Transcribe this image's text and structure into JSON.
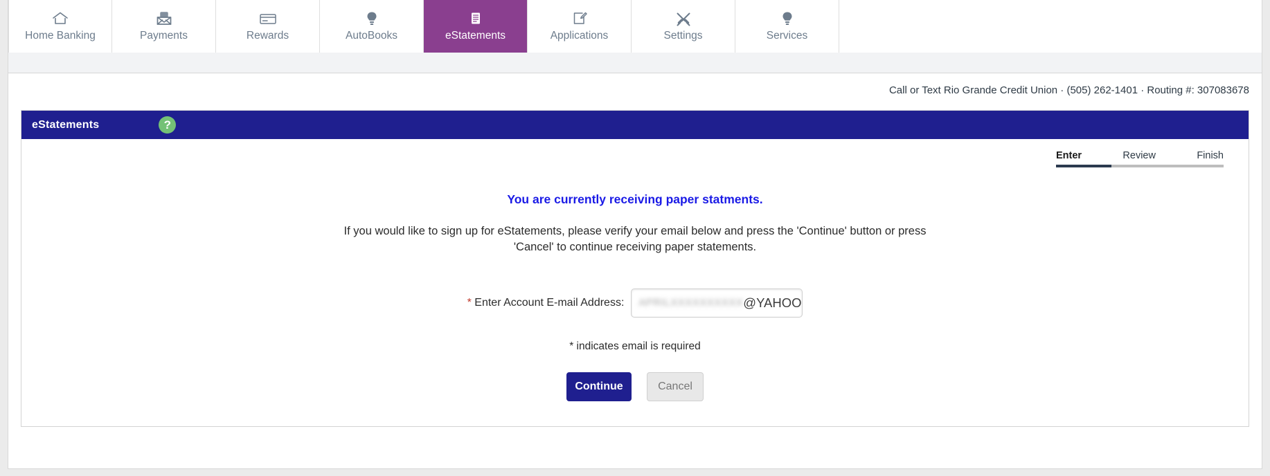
{
  "nav": {
    "tabs": [
      {
        "label": "Home Banking",
        "icon": "home-icon",
        "active": false
      },
      {
        "label": "Payments",
        "icon": "envelope-money-icon",
        "active": false
      },
      {
        "label": "Rewards",
        "icon": "credit-card-icon",
        "active": false
      },
      {
        "label": "AutoBooks",
        "icon": "lightbulb-icon",
        "active": false
      },
      {
        "label": "eStatements",
        "icon": "document-lines-icon",
        "active": true
      },
      {
        "label": "Applications",
        "icon": "form-edit-icon",
        "active": false
      },
      {
        "label": "Settings",
        "icon": "tools-icon",
        "active": false
      },
      {
        "label": "Services",
        "icon": "lightbulb-icon",
        "active": false
      }
    ],
    "active_tab_color": "#8a3f8f",
    "tab_text_color": "#6d7c8c"
  },
  "contact": {
    "text": "Call or Text Rio Grande Credit Union · (505) 262-1401 · Routing #: 307083678"
  },
  "panel": {
    "title": "eStatements",
    "header_color": "#1f1f8f",
    "help_icon_label": "?",
    "help_icon_color": "#74c176"
  },
  "steps": {
    "items": [
      {
        "label": "Enter",
        "active": true
      },
      {
        "label": "Review",
        "active": false
      },
      {
        "label": "Finish",
        "active": false
      }
    ],
    "progress_percent": 33,
    "active_color": "#2b3a4f",
    "track_color": "#bdbdbd"
  },
  "main": {
    "headline": "You are currently receiving paper statments.",
    "headline_color": "#1a1ae6",
    "instructions": "If you would like to sign up for eStatements, please verify your email below and press the 'Continue' button or press 'Cancel' to continue receiving paper statements.",
    "field": {
      "label_star": "*",
      "label": " Enter Account E-mail Address:",
      "value_redacted": "APRILXXXXXXXXXX",
      "value_visible": "@YAHOO.C",
      "placeholder": ""
    },
    "required_note": "* indicates email is required",
    "buttons": {
      "continue_label": "Continue",
      "cancel_label": "Cancel",
      "continue_color": "#1f1f8f",
      "cancel_color": "#e8e8e8"
    }
  }
}
